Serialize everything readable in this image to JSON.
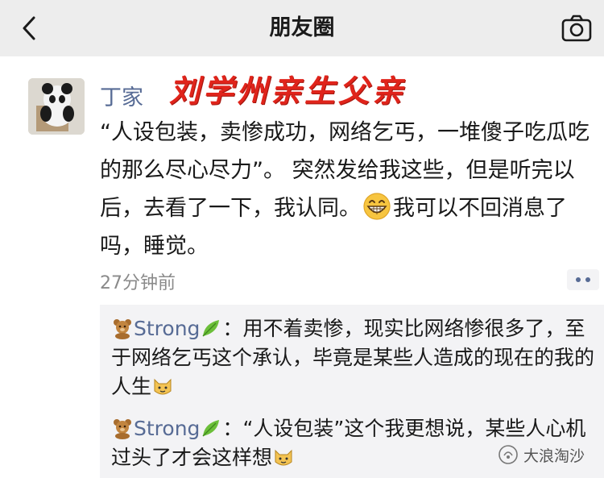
{
  "nav": {
    "title": "朋友圈",
    "back_icon": "chevron-left-icon",
    "camera_icon": "camera-icon"
  },
  "overlay": {
    "text": "刘学州亲生父亲",
    "color": "#e0241b"
  },
  "post": {
    "author": "丁家",
    "text_before_emoji": "“人设包装，卖惨成功，网络乞丐，一堆傻子吃瓜吃的那么尽心尽力”。 突然发给我这些，但是听完以后，去看了一下，我认同。",
    "emoji": "grinning-face-icon",
    "text_after_emoji": "我可以不回消息了吗，睡觉。",
    "time": "27分钟前"
  },
  "comments": [
    {
      "author": "Strong",
      "sep": "：",
      "text": "用不着卖惨，现实比网络惨很多了，至于网络乞丐这个承认，毕竟是某些人造成的现在的我的人生"
    },
    {
      "author": "Strong",
      "sep": "：",
      "text": "“人设包装”这个我更想说，某些人心机过头了才会这样想"
    }
  ],
  "watermark": {
    "text": "大浪淘沙"
  },
  "colors": {
    "link": "#576b95",
    "topbar": "#ededed",
    "comment_bg": "#f3f3f5"
  }
}
